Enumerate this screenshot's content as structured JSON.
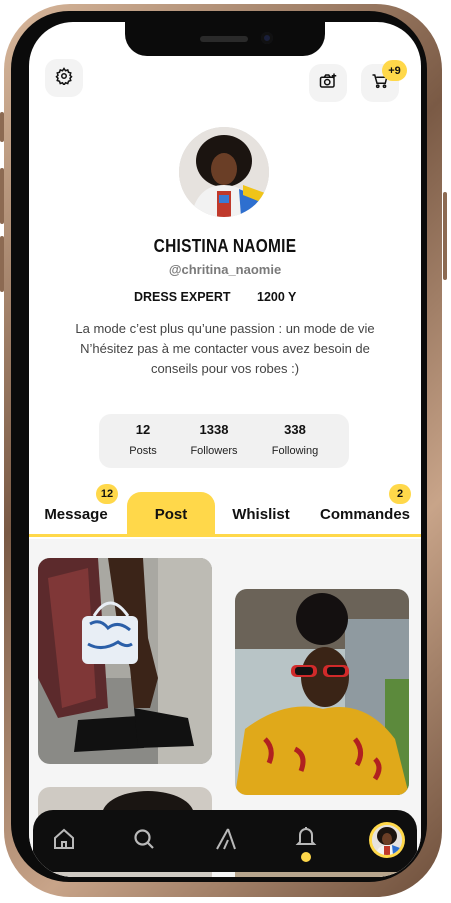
{
  "header": {
    "settings_icon": "gear-icon",
    "camera_icon": "camera-plus-icon",
    "cart_icon": "cart-icon",
    "cart_badge": "+9"
  },
  "profile": {
    "name": "CHISTINA NAOMIE",
    "handle": "@chritina_naomie",
    "role": "DRESS EXPERT",
    "years": "1200 Y",
    "bio_line1": "La mode c’est plus qu’une passion : un mode de vie",
    "bio_line2": "N’hésitez pas à me contacter vous avez besoin de",
    "bio_line3": "conseils pour vos robes :)"
  },
  "stats": [
    {
      "value": "12",
      "label": "Posts"
    },
    {
      "value": "1338",
      "label": "Followers"
    },
    {
      "value": "338",
      "label": "Following"
    }
  ],
  "tabs": [
    {
      "label": "Message",
      "badge": "12"
    },
    {
      "label": "Post",
      "active": true
    },
    {
      "label": "Whislist"
    },
    {
      "label": "Commandes",
      "badge": "2"
    }
  ],
  "navbar": {
    "items": [
      "home-icon",
      "search-icon",
      "brand-logo-icon",
      "bell-icon",
      "profile-avatar"
    ]
  },
  "colors": {
    "accent": "#ffd84a",
    "dark": "#0e0e0e",
    "muted": "#7a7a7a"
  }
}
